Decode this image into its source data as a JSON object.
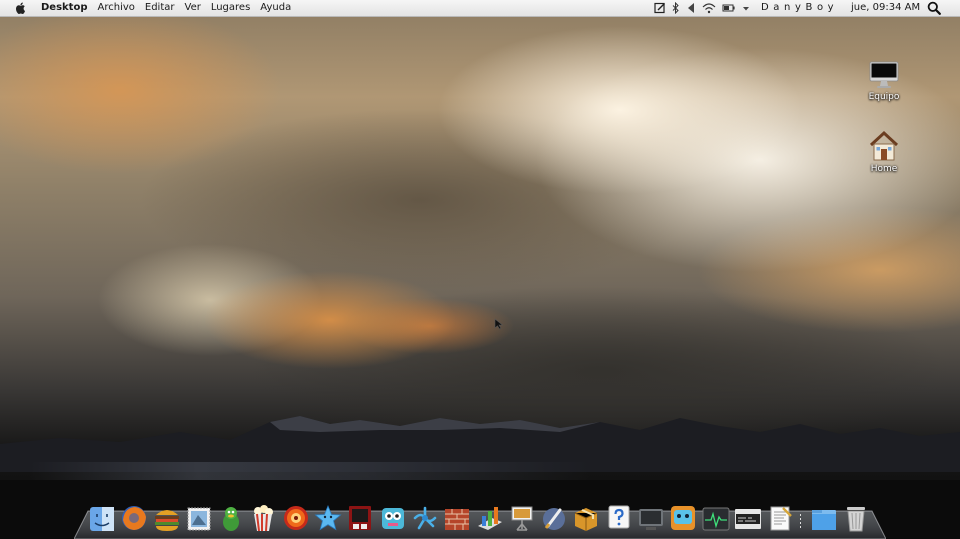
{
  "menubar": {
    "apple_icon": "apple-logo-icon",
    "app_name": "Desktop",
    "menus": [
      "Archivo",
      "Editar",
      "Ver",
      "Lugares",
      "Ayuda"
    ],
    "tray_icons": [
      "notes-icon",
      "bluetooth-icon",
      "volume-icon",
      "wifi-icon",
      "battery-icon",
      "dropdown-arrow-icon"
    ],
    "user_name": "DanyBoy",
    "clock": "jue, 09:34 AM",
    "search_icon": "spotlight-search-icon"
  },
  "desktop_icons": [
    {
      "label": "Equipo",
      "icon": "computer-monitor-icon"
    },
    {
      "label": "Home",
      "icon": "home-folder-icon"
    }
  ],
  "dock": {
    "apps": [
      {
        "name": "Finder",
        "icon": "finder-icon"
      },
      {
        "name": "Firefox",
        "icon": "firefox-icon"
      },
      {
        "name": "Burger",
        "icon": "burger-app-icon"
      },
      {
        "name": "Mail Stamp",
        "icon": "mail-stamp-icon"
      },
      {
        "name": "Adium",
        "icon": "adium-duck-icon"
      },
      {
        "name": "Popcorn",
        "icon": "popcorn-icon"
      },
      {
        "name": "Player",
        "icon": "media-player-icon"
      },
      {
        "name": "Star",
        "icon": "star-app-icon"
      },
      {
        "name": "Photo Booth",
        "icon": "photo-booth-icon"
      },
      {
        "name": "Robot",
        "icon": "robot-app-icon"
      },
      {
        "name": "Network",
        "icon": "network-app-icon"
      },
      {
        "name": "Firewall",
        "icon": "firewall-icon"
      },
      {
        "name": "Grapher",
        "icon": "grapher-icon"
      },
      {
        "name": "Keynote",
        "icon": "keynote-icon"
      },
      {
        "name": "Brush",
        "icon": "brush-app-icon"
      },
      {
        "name": "Package",
        "icon": "package-icon"
      },
      {
        "name": "Help",
        "icon": "help-icon"
      },
      {
        "name": "Screen",
        "icon": "screen-app-icon"
      },
      {
        "name": "Face",
        "icon": "face-app-icon"
      },
      {
        "name": "Activity Monitor",
        "icon": "activity-monitor-icon"
      },
      {
        "name": "Console",
        "icon": "console-icon"
      },
      {
        "name": "TextEdit",
        "icon": "textedit-icon"
      }
    ],
    "stacks": [
      {
        "name": "Folder",
        "icon": "blue-folder-icon"
      },
      {
        "name": "Trash",
        "icon": "trash-icon"
      }
    ]
  },
  "colors": {
    "menubar_bg": "#eeeeee",
    "label_text": "#ffffff"
  }
}
